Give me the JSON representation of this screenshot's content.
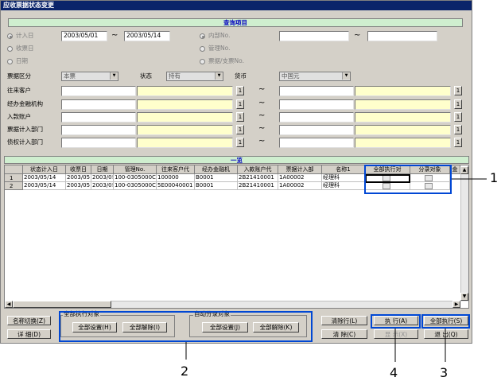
{
  "window": {
    "title": "应收票据状态变更"
  },
  "query": {
    "header": "查询项目",
    "radios": [
      "计入日",
      "收票日",
      "日期"
    ],
    "radios_right": [
      "内部No.",
      "管理No.",
      "票据/支票No."
    ],
    "date_from": "2003/05/01",
    "date_to": "2003/05/14",
    "tilde": "~",
    "kind_label": "票据区分",
    "kind_value": "本票",
    "status_label": "状态",
    "status_value": "持有",
    "currency_label": "货币",
    "currency_value": "中国元",
    "rows": [
      "往来客户",
      "经办金融机构",
      "入款账户",
      "票据计入部门",
      "债权计入部门"
    ],
    "btn": "1"
  },
  "list": {
    "header": "一览",
    "columns": [
      "状态计入日",
      "收票日",
      "日期",
      "管理No.",
      "往来客户代",
      "经办金融机",
      "入款账户代",
      "票据计入部",
      "名称1",
      "全部执行对",
      "分录对象",
      "金"
    ],
    "rows": [
      {
        "idx": "1",
        "cells": [
          "2003/05/14",
          "2003/05",
          "2003/0!",
          "100-0305000C",
          "100000",
          "B0001",
          "2B21410001",
          "1A00002",
          "经理科"
        ]
      },
      {
        "idx": "2",
        "cells": [
          "2003/05/14",
          "2003/05",
          "2003/0!",
          "100-0305000C",
          "5E00040001",
          "B0001",
          "2B21410001",
          "1A00002",
          "经理科"
        ]
      }
    ]
  },
  "bottom": {
    "switch_name": "名称切换(Z)",
    "detail": "详  细(D)",
    "group1_title": "全部执行对象",
    "group1_set": "全部设置(H)",
    "group1_clear": "全部解除(I)",
    "group2_title": "自动分录对象",
    "group2_set": "全部设置(J)",
    "group2_clear": "全部解除(K)",
    "clear_rows": "清除行(L)",
    "clear": "清  除(C)",
    "execute": "执  行(A)",
    "show": "显  示(X)",
    "execute_all": "全部执行(S)",
    "exit": "退  出(Q)"
  },
  "callouts": [
    "1",
    "2",
    "3",
    "4"
  ],
  "colors": {
    "highlight": "#0047d4",
    "title_bar": "#0a246a",
    "header_green": "#cfeecf",
    "yellow_field": "#ffffcc"
  }
}
